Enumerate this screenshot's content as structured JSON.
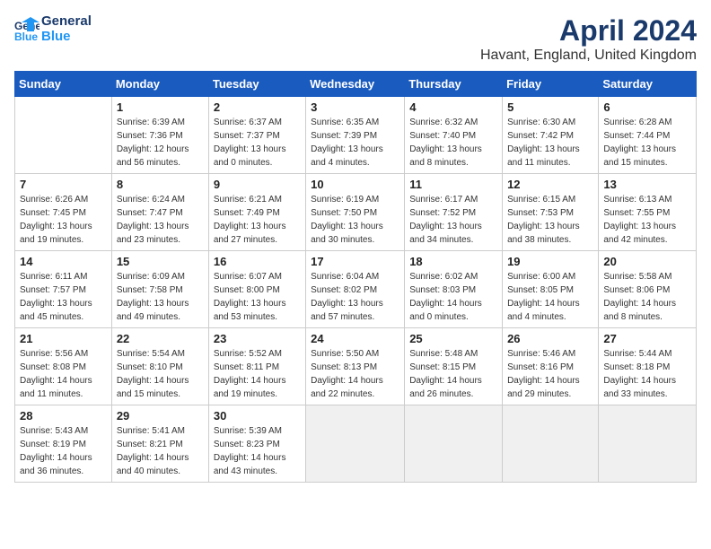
{
  "header": {
    "logo_line1": "General",
    "logo_line2": "Blue",
    "title": "April 2024",
    "subtitle": "Havant, England, United Kingdom"
  },
  "weekdays": [
    "Sunday",
    "Monday",
    "Tuesday",
    "Wednesday",
    "Thursday",
    "Friday",
    "Saturday"
  ],
  "weeks": [
    [
      {
        "day": "",
        "info": ""
      },
      {
        "day": "1",
        "info": "Sunrise: 6:39 AM\nSunset: 7:36 PM\nDaylight: 12 hours\nand 56 minutes."
      },
      {
        "day": "2",
        "info": "Sunrise: 6:37 AM\nSunset: 7:37 PM\nDaylight: 13 hours\nand 0 minutes."
      },
      {
        "day": "3",
        "info": "Sunrise: 6:35 AM\nSunset: 7:39 PM\nDaylight: 13 hours\nand 4 minutes."
      },
      {
        "day": "4",
        "info": "Sunrise: 6:32 AM\nSunset: 7:40 PM\nDaylight: 13 hours\nand 8 minutes."
      },
      {
        "day": "5",
        "info": "Sunrise: 6:30 AM\nSunset: 7:42 PM\nDaylight: 13 hours\nand 11 minutes."
      },
      {
        "day": "6",
        "info": "Sunrise: 6:28 AM\nSunset: 7:44 PM\nDaylight: 13 hours\nand 15 minutes."
      }
    ],
    [
      {
        "day": "7",
        "info": "Sunrise: 6:26 AM\nSunset: 7:45 PM\nDaylight: 13 hours\nand 19 minutes."
      },
      {
        "day": "8",
        "info": "Sunrise: 6:24 AM\nSunset: 7:47 PM\nDaylight: 13 hours\nand 23 minutes."
      },
      {
        "day": "9",
        "info": "Sunrise: 6:21 AM\nSunset: 7:49 PM\nDaylight: 13 hours\nand 27 minutes."
      },
      {
        "day": "10",
        "info": "Sunrise: 6:19 AM\nSunset: 7:50 PM\nDaylight: 13 hours\nand 30 minutes."
      },
      {
        "day": "11",
        "info": "Sunrise: 6:17 AM\nSunset: 7:52 PM\nDaylight: 13 hours\nand 34 minutes."
      },
      {
        "day": "12",
        "info": "Sunrise: 6:15 AM\nSunset: 7:53 PM\nDaylight: 13 hours\nand 38 minutes."
      },
      {
        "day": "13",
        "info": "Sunrise: 6:13 AM\nSunset: 7:55 PM\nDaylight: 13 hours\nand 42 minutes."
      }
    ],
    [
      {
        "day": "14",
        "info": "Sunrise: 6:11 AM\nSunset: 7:57 PM\nDaylight: 13 hours\nand 45 minutes."
      },
      {
        "day": "15",
        "info": "Sunrise: 6:09 AM\nSunset: 7:58 PM\nDaylight: 13 hours\nand 49 minutes."
      },
      {
        "day": "16",
        "info": "Sunrise: 6:07 AM\nSunset: 8:00 PM\nDaylight: 13 hours\nand 53 minutes."
      },
      {
        "day": "17",
        "info": "Sunrise: 6:04 AM\nSunset: 8:02 PM\nDaylight: 13 hours\nand 57 minutes."
      },
      {
        "day": "18",
        "info": "Sunrise: 6:02 AM\nSunset: 8:03 PM\nDaylight: 14 hours\nand 0 minutes."
      },
      {
        "day": "19",
        "info": "Sunrise: 6:00 AM\nSunset: 8:05 PM\nDaylight: 14 hours\nand 4 minutes."
      },
      {
        "day": "20",
        "info": "Sunrise: 5:58 AM\nSunset: 8:06 PM\nDaylight: 14 hours\nand 8 minutes."
      }
    ],
    [
      {
        "day": "21",
        "info": "Sunrise: 5:56 AM\nSunset: 8:08 PM\nDaylight: 14 hours\nand 11 minutes."
      },
      {
        "day": "22",
        "info": "Sunrise: 5:54 AM\nSunset: 8:10 PM\nDaylight: 14 hours\nand 15 minutes."
      },
      {
        "day": "23",
        "info": "Sunrise: 5:52 AM\nSunset: 8:11 PM\nDaylight: 14 hours\nand 19 minutes."
      },
      {
        "day": "24",
        "info": "Sunrise: 5:50 AM\nSunset: 8:13 PM\nDaylight: 14 hours\nand 22 minutes."
      },
      {
        "day": "25",
        "info": "Sunrise: 5:48 AM\nSunset: 8:15 PM\nDaylight: 14 hours\nand 26 minutes."
      },
      {
        "day": "26",
        "info": "Sunrise: 5:46 AM\nSunset: 8:16 PM\nDaylight: 14 hours\nand 29 minutes."
      },
      {
        "day": "27",
        "info": "Sunrise: 5:44 AM\nSunset: 8:18 PM\nDaylight: 14 hours\nand 33 minutes."
      }
    ],
    [
      {
        "day": "28",
        "info": "Sunrise: 5:43 AM\nSunset: 8:19 PM\nDaylight: 14 hours\nand 36 minutes."
      },
      {
        "day": "29",
        "info": "Sunrise: 5:41 AM\nSunset: 8:21 PM\nDaylight: 14 hours\nand 40 minutes."
      },
      {
        "day": "30",
        "info": "Sunrise: 5:39 AM\nSunset: 8:23 PM\nDaylight: 14 hours\nand 43 minutes."
      },
      {
        "day": "",
        "info": ""
      },
      {
        "day": "",
        "info": ""
      },
      {
        "day": "",
        "info": ""
      },
      {
        "day": "",
        "info": ""
      }
    ]
  ]
}
